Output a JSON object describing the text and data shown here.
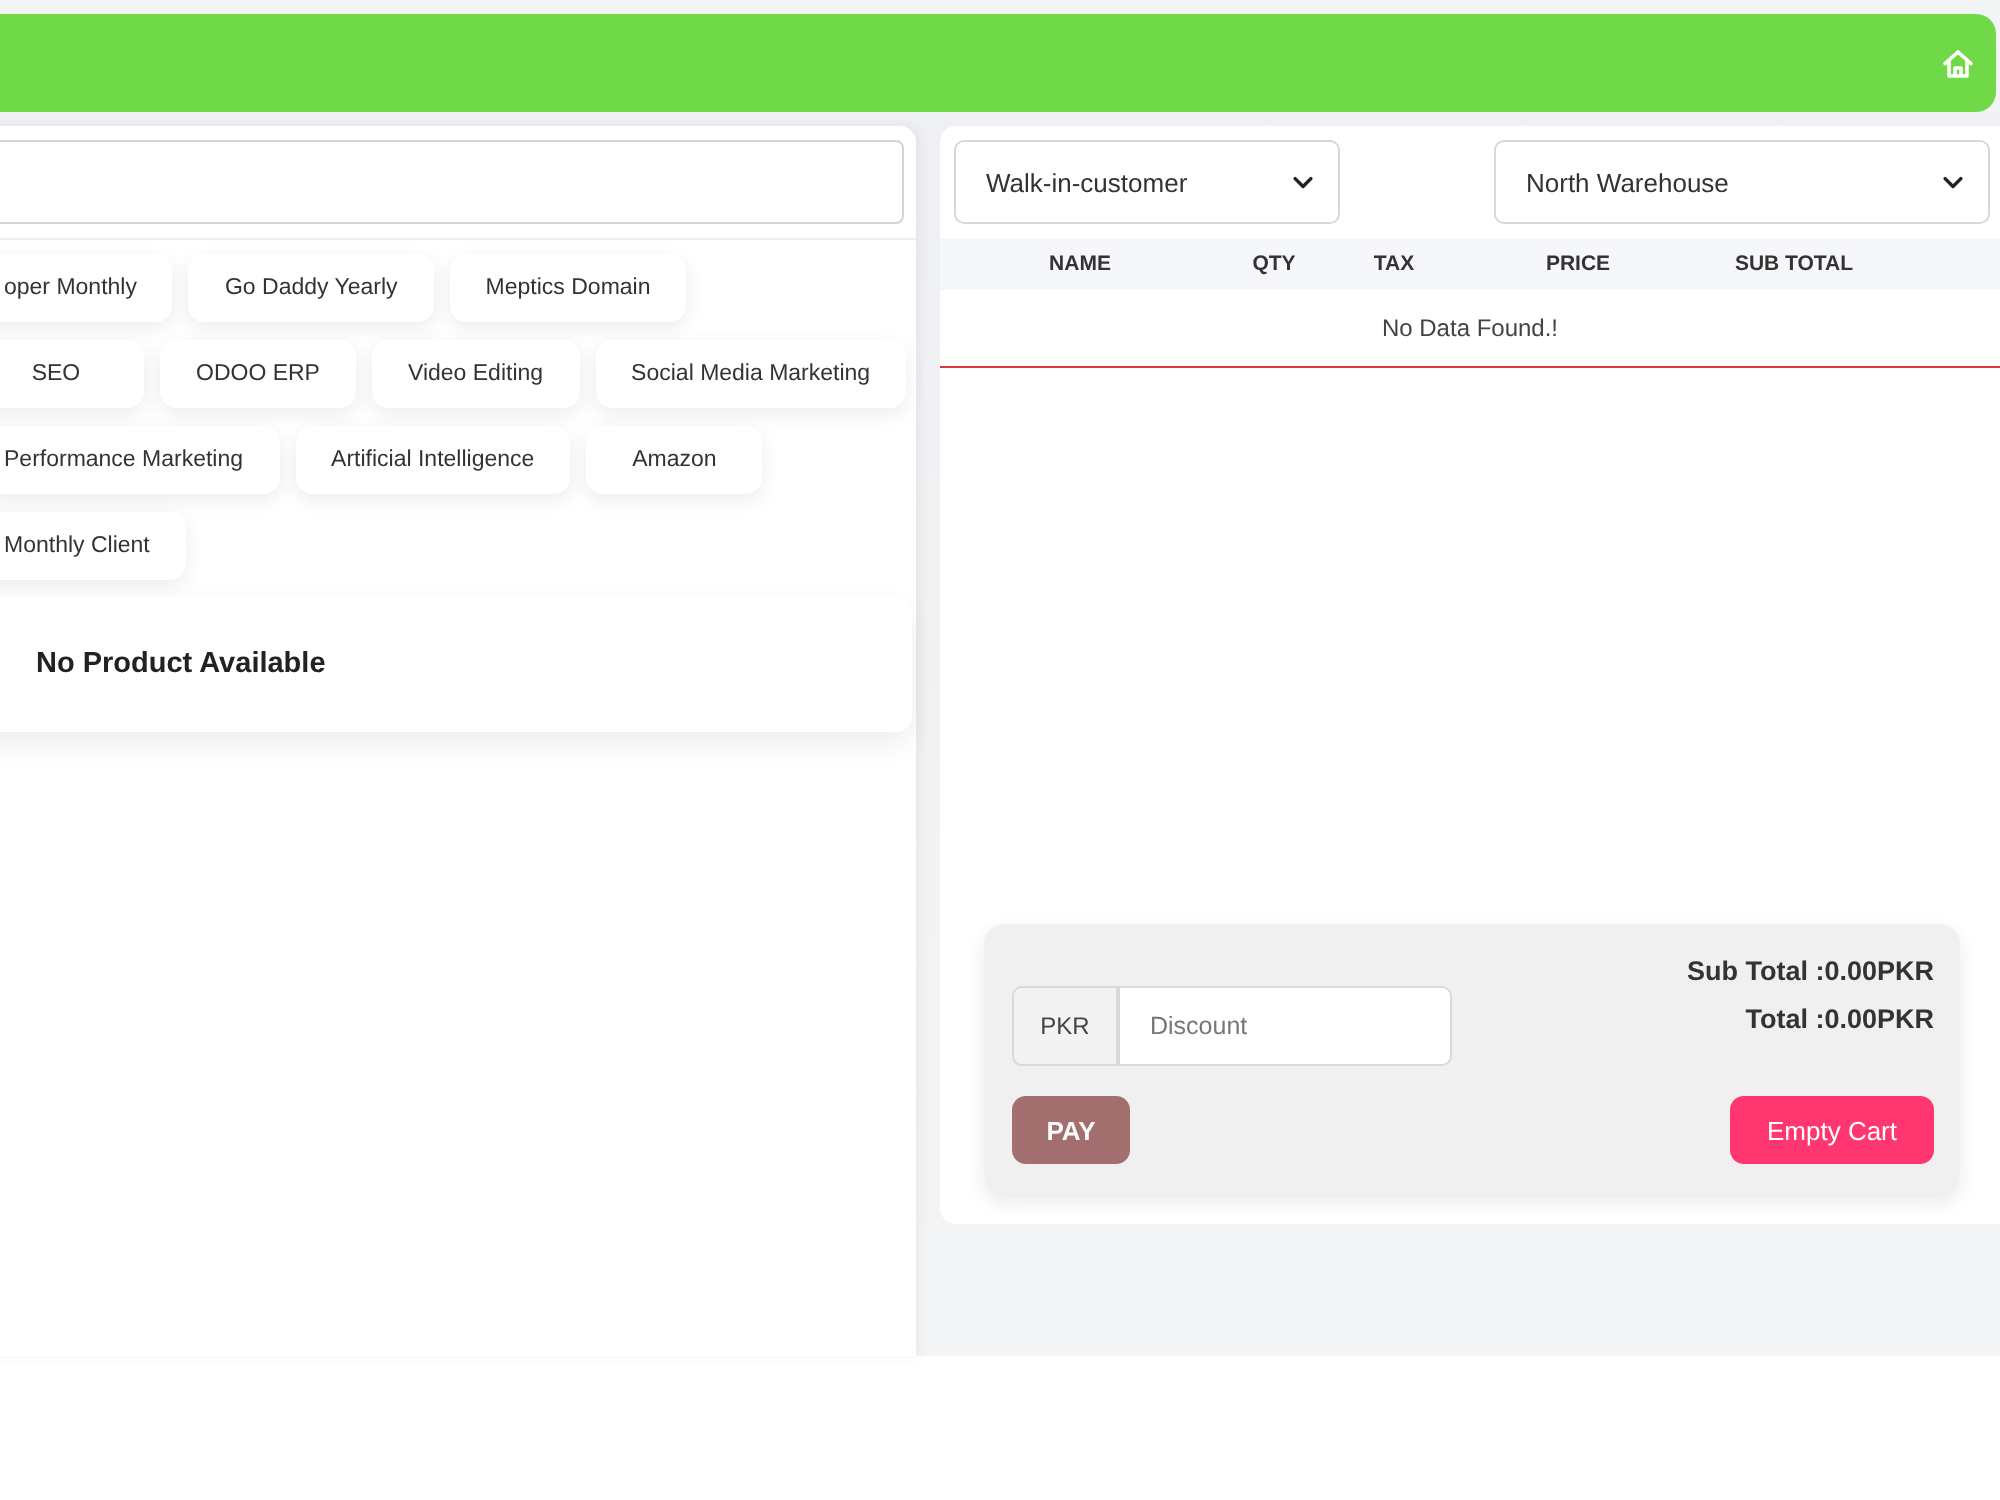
{
  "product_panel": {
    "categories": [
      {
        "label": "oper Monthly"
      },
      {
        "label": "Go Daddy Yearly"
      },
      {
        "label": "Meptics Domain"
      },
      {
        "label": "SEO"
      },
      {
        "label": "ODOO ERP"
      },
      {
        "label": "Video Editing"
      },
      {
        "label": "Social Media Marketing"
      },
      {
        "label": "Performance Marketing"
      },
      {
        "label": "Artificial Intelligence"
      },
      {
        "label": "Amazon"
      },
      {
        "label": "Monthly Client"
      }
    ],
    "empty_message": "No Product Available"
  },
  "cart_panel": {
    "customer_select": {
      "value": "Walk-in-customer"
    },
    "warehouse_select": {
      "value": "North Warehouse"
    },
    "table": {
      "columns": [
        "NAME",
        "QTY",
        "TAX",
        "PRICE",
        "SUB TOTAL"
      ],
      "empty_message": "No Data Found.!"
    },
    "summary": {
      "currency_addon": "PKR",
      "discount": {
        "placeholder": "Discount"
      },
      "sub_total": "Sub Total :0.00PKR",
      "total": "Total :0.00PKR",
      "buttons": [
        {
          "label": "PAY",
          "kind": "pay",
          "disabled": true
        },
        {
          "label": "Empty Cart",
          "kind": "clear",
          "disabled": false
        }
      ]
    }
  }
}
